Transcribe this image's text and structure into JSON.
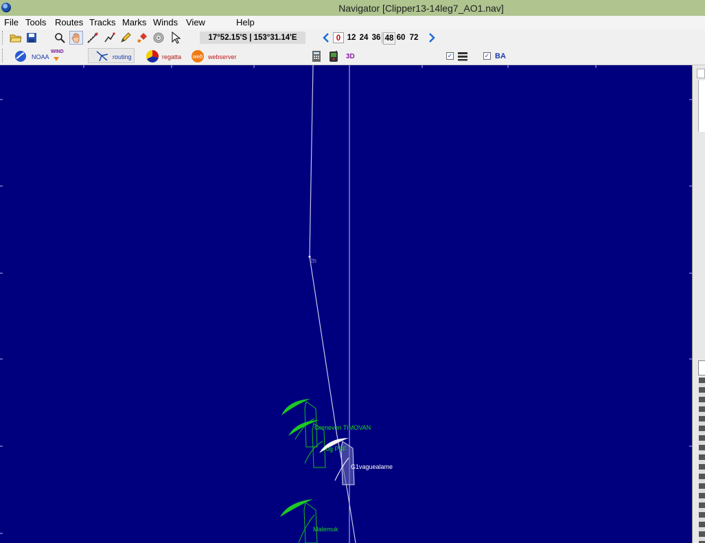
{
  "window": {
    "title": "Navigator [Clipper13-14leg7_AO1.nav]"
  },
  "menu": [
    "File",
    "Tools",
    "Routes",
    "Tracks",
    "Marks",
    "Winds",
    "View",
    "Help"
  ],
  "toolbar": {
    "icons": [
      "open-folder-icon",
      "save-icon",
      "zoom-icon",
      "pan-hand-icon",
      "measure-icon",
      "route-icon",
      "pencil-icon",
      "paint-icon",
      "target-icon",
      "pointer-icon"
    ],
    "coordinates": "17°52.15'S | 153°31.14'E",
    "hours": [
      "0",
      "12",
      "24",
      "36",
      "48",
      "60",
      "72"
    ],
    "selected_hour": "0"
  },
  "plugins": {
    "noaa": "NOAA",
    "wind": "WIND",
    "routing": "routing",
    "regatta": "regatta",
    "webserver": "webserver",
    "three_d": "3D",
    "ba": "BA"
  },
  "map": {
    "waypoint_label": "2h",
    "boats": [
      {
        "label": "Greneven TIMOVAN",
        "color": "#1fd41f"
      },
      {
        "label": "og PBF",
        "color": "#1fd41f"
      },
      {
        "label": "G1vaguealame",
        "color": "#ffffff"
      },
      {
        "label": "Malemuk",
        "color": "#1fd41f"
      }
    ]
  },
  "colors": {
    "map_bg": "#00007f",
    "titlebar": "#afc48f",
    "boat_green": "#1fd41f"
  }
}
